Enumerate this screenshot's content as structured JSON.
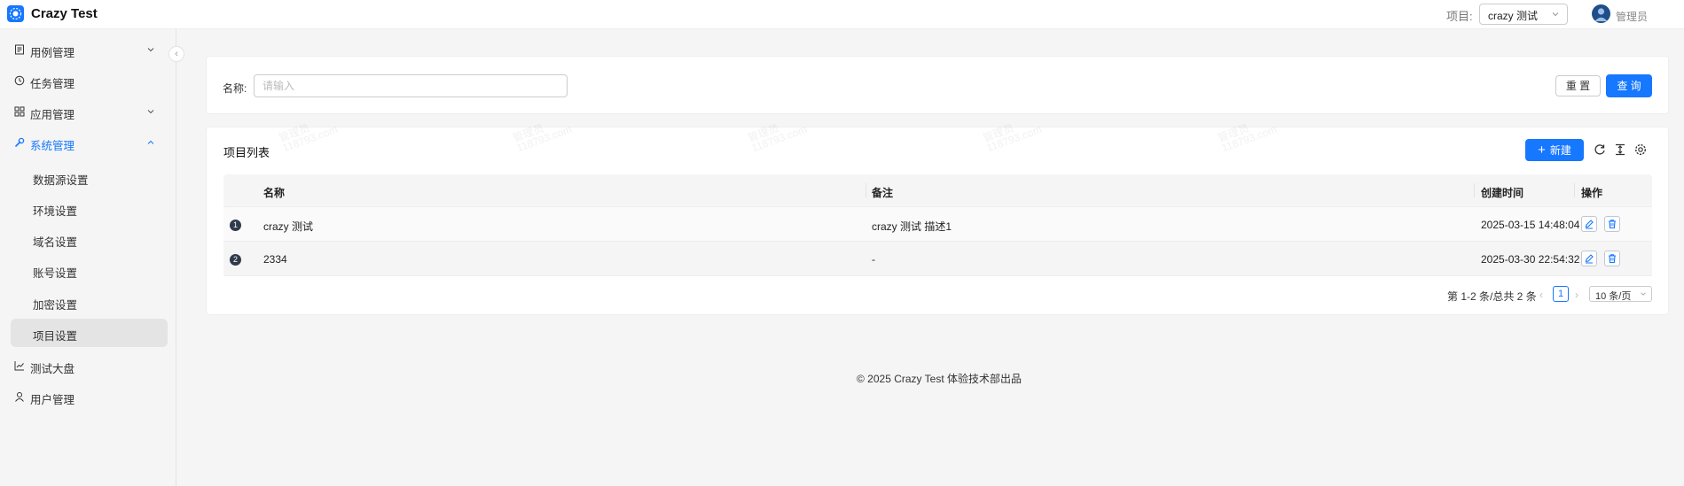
{
  "header": {
    "app_title": "Crazy Test",
    "project_label": "项目:",
    "project_value": "crazy 测试",
    "user_name": "管理员"
  },
  "sidebar": {
    "menu": [
      {
        "label": "用例管理",
        "icon": "file-icon",
        "expandable": true
      },
      {
        "label": "任务管理",
        "icon": "clock-icon"
      },
      {
        "label": "应用管理",
        "icon": "grid-icon",
        "expandable": true
      },
      {
        "label": "系统管理",
        "icon": "wrench-icon",
        "expanded": true,
        "active": true
      }
    ],
    "submenu": [
      {
        "label": "数据源设置"
      },
      {
        "label": "环境设置"
      },
      {
        "label": "域名设置"
      },
      {
        "label": "账号设置"
      },
      {
        "label": "加密设置"
      },
      {
        "label": "项目设置",
        "selected": true
      }
    ],
    "menu_after": [
      {
        "label": "测试大盘",
        "icon": "chart-icon"
      },
      {
        "label": "用户管理",
        "icon": "user-icon"
      }
    ]
  },
  "search": {
    "name_label": "名称:",
    "name_placeholder": "请输入",
    "reset_label": "重 置",
    "query_label": "查 询"
  },
  "list": {
    "title": "项目列表",
    "new_label": "新建",
    "watermark_lines": [
      "管理员",
      "118793.com"
    ],
    "columns": [
      "名称",
      "备注",
      "创建时间",
      "操作"
    ],
    "rows": [
      {
        "index": "1",
        "name": "crazy 测试",
        "remark": "crazy 测试 描述1",
        "created": "2025-03-15 14:48:04"
      },
      {
        "index": "2",
        "name": "2334",
        "remark": "-",
        "created": "2025-03-30 22:54:32"
      }
    ],
    "pagination": {
      "total_text": "第 1-2 条/总共 2 条",
      "current_page": "1",
      "page_size": "10 条/页"
    }
  },
  "footer": {
    "text": "© 2025 Crazy Test 体验技术部出品"
  },
  "colors": {
    "primary": "#1677ff",
    "sidebar_selected_bg": "#e4e4e4",
    "page_bg": "#f5f5f5"
  }
}
